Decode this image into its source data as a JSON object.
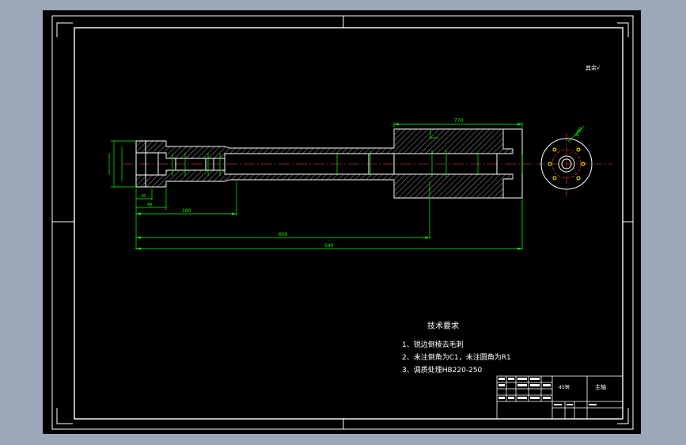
{
  "drawing": {
    "corner_note": "其余√",
    "dimensions": {
      "d770": "770",
      "d180": "180",
      "d600": "600",
      "d540": "540",
      "d48": "48",
      "d36": "36",
      "bolt_circle": "Φ90"
    },
    "tech_requirements": {
      "title": "技术要求",
      "items": [
        "1、锐边倒棱去毛刺",
        "2、未注倒角为C1，未注圆角为R1",
        "3、调质处理HB220-250"
      ]
    },
    "title_block": {
      "material": "45钢",
      "part_name": "主轴"
    }
  },
  "colors": {
    "background": "#000000",
    "frame": "#ffffff",
    "dimension": "#00ff00",
    "surround": "#9aa7b8"
  }
}
